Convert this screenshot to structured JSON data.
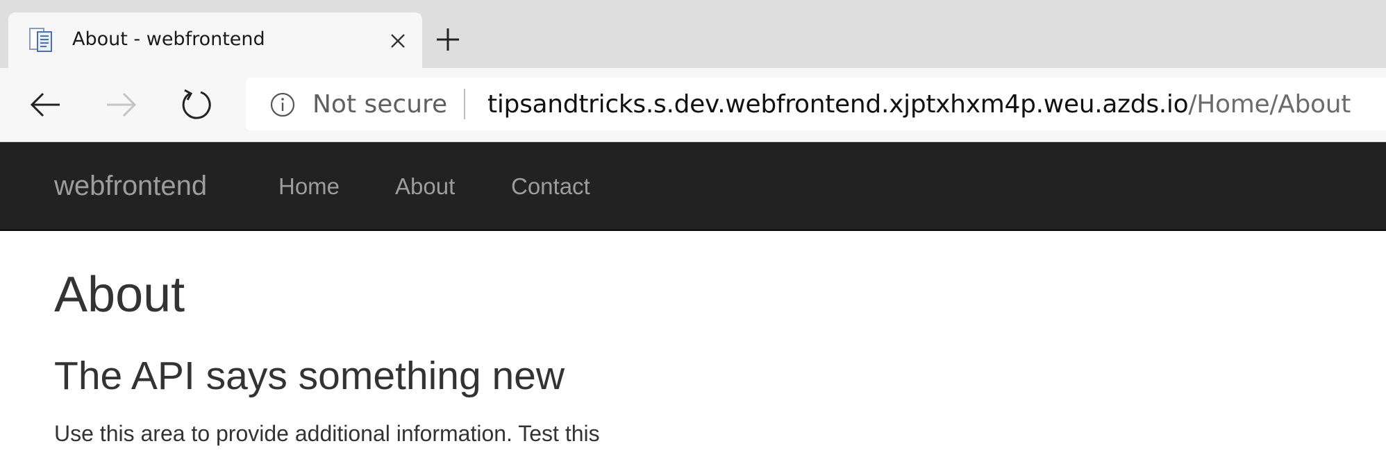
{
  "browser": {
    "tab": {
      "title": "About - webfrontend",
      "favicon": "page-icon",
      "close_icon": "close-icon"
    },
    "new_tab_icon": "plus-icon",
    "toolbar": {
      "back_icon": "arrow-left-icon",
      "forward_icon": "arrow-right-icon",
      "refresh_icon": "refresh-icon"
    },
    "address_bar": {
      "security_icon": "info-icon",
      "security_text": "Not secure",
      "url_host": "tipsandtricks.s.dev.webfrontend.xjptxhxm4p.weu.azds.io",
      "url_path": "/Home/About"
    }
  },
  "site": {
    "brand": "webfrontend",
    "nav": [
      {
        "label": "Home"
      },
      {
        "label": "About"
      },
      {
        "label": "Contact"
      }
    ]
  },
  "main": {
    "title": "About",
    "subtitle": "The API says something new",
    "body": "Use this area to provide additional information. Test this"
  },
  "colors": {
    "navbar_bg": "#222222",
    "nav_text": "#9d9d9d",
    "body_text": "#333333",
    "tabstrip_bg": "#dedede",
    "toolbar_bg": "#f7f7f7"
  }
}
